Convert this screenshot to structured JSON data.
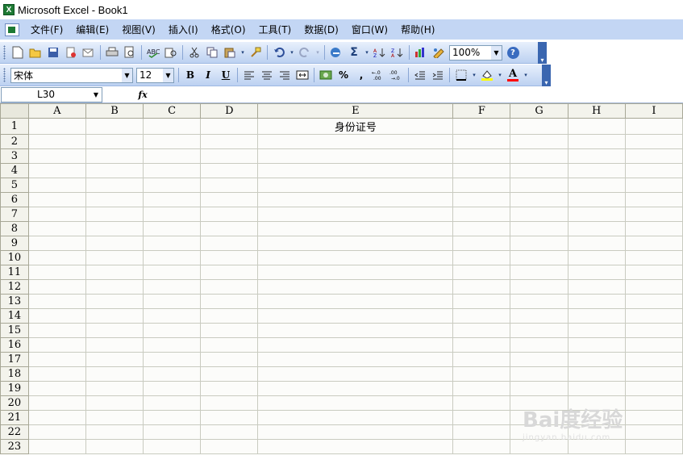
{
  "window": {
    "title": "Microsoft Excel - Book1"
  },
  "menu": [
    "文件(F)",
    "编辑(E)",
    "视图(V)",
    "插入(I)",
    "格式(O)",
    "工具(T)",
    "数据(D)",
    "窗口(W)",
    "帮助(H)"
  ],
  "toolbar_standard": {
    "zoom": "100%",
    "buttons": [
      "new-icon",
      "open-icon",
      "save-icon",
      "permission-icon",
      "email-icon",
      "print-icon",
      "print-preview-icon",
      "spelling-icon",
      "research-icon",
      "cut-icon",
      "copy-icon",
      "paste-icon",
      "format-painter-icon",
      "undo-icon",
      "redo-icon",
      "hyperlink-icon",
      "autosum-icon",
      "sort-asc-icon",
      "sort-desc-icon",
      "chart-wizard-icon",
      "drawing-icon",
      "help-icon"
    ],
    "glyphs": {
      "autosum": "Σ",
      "help": "?"
    }
  },
  "toolbar_formatting": {
    "font": "宋体",
    "size": "12",
    "bold": "B",
    "italic": "I",
    "underline": "U",
    "percent": "%",
    "comma": ",",
    "fill_color": "#ffff00",
    "font_color": "#ff0000",
    "font_color_letter": "A"
  },
  "formula_bar": {
    "name_box": "L30",
    "fx_label": "fx",
    "content": ""
  },
  "sheet": {
    "columns": [
      "A",
      "B",
      "C",
      "D",
      "E",
      "F",
      "G",
      "H",
      "I"
    ],
    "rows": [
      "1",
      "2",
      "3",
      "4",
      "5",
      "6",
      "7",
      "8",
      "9",
      "10",
      "11",
      "12",
      "13",
      "14",
      "15",
      "16",
      "17",
      "18",
      "19",
      "20",
      "21",
      "22",
      "23"
    ],
    "cells": {
      "E1": "身份证号"
    }
  },
  "watermark": {
    "text": "Bai度经验",
    "sub": "jingyan.baidu.com"
  }
}
